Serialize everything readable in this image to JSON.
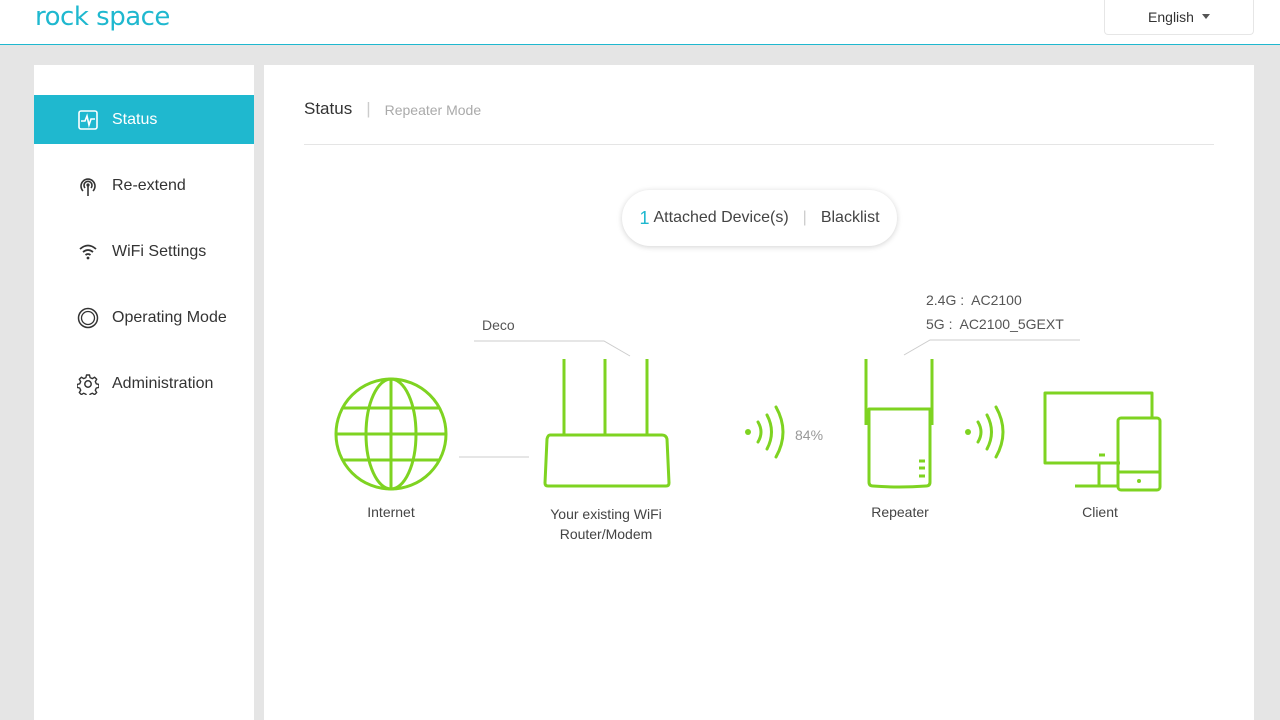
{
  "header": {
    "logo": "rock space",
    "language": "English"
  },
  "sidebar": {
    "items": [
      {
        "label": "Status",
        "icon": "activity-icon",
        "active": true
      },
      {
        "label": "Re-extend",
        "icon": "signal-tower-icon"
      },
      {
        "label": "WiFi Settings",
        "icon": "wifi-icon"
      },
      {
        "label": "Operating Mode",
        "icon": "circle-icon"
      },
      {
        "label": "Administration",
        "icon": "gear-icon"
      }
    ]
  },
  "main": {
    "title": "Status",
    "mode": "Repeater Mode",
    "devices": {
      "count": "1",
      "label": "Attached Device(s)",
      "blacklist": "Blacklist"
    },
    "topology": {
      "router_name": "Deco",
      "band_24_label": "2.4G :",
      "band_24_ssid": "AC2100",
      "band_5_label": "5G :",
      "band_5_ssid": "AC2100_5GEXT",
      "signal": "84%",
      "internet_label": "Internet",
      "router_label_line1": "Your existing WiFi",
      "router_label_line2": "Router/Modem",
      "repeater_label": "Repeater",
      "client_label": "Client"
    }
  },
  "colors": {
    "accent": "#1fb8cf",
    "device_green": "#7ed321"
  }
}
